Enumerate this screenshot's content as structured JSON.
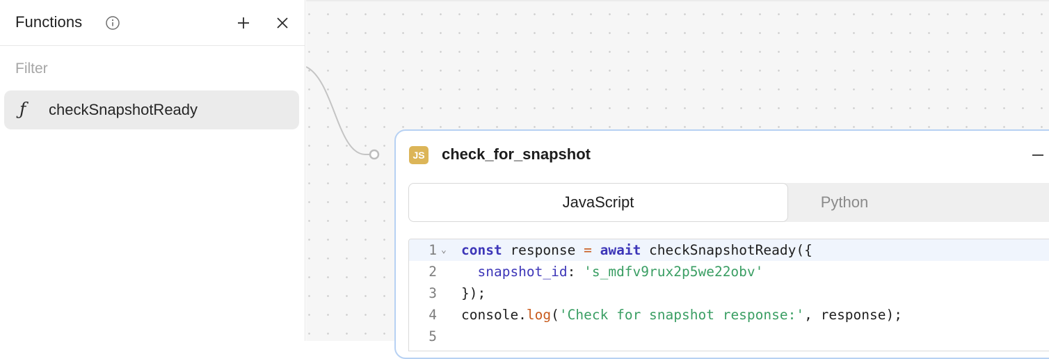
{
  "sidebar": {
    "title": "Functions",
    "filter_placeholder": "Filter",
    "items": [
      {
        "glyph": "ƒ",
        "label": "checkSnapshotReady"
      }
    ]
  },
  "node": {
    "badge": "JS",
    "title": "check_for_snapshot",
    "tabs": [
      {
        "label": "JavaScript",
        "active": true
      },
      {
        "label": "Python",
        "active": false
      }
    ],
    "line_numbers": [
      "1",
      "2",
      "3",
      "4",
      "5"
    ],
    "code": {
      "line1": {
        "kw1": "const",
        "t1": " response ",
        "op": "=",
        "t2": " ",
        "kw2": "await",
        "t3": " checkSnapshotReady({"
      },
      "line2": {
        "indent": "  ",
        "prop": "snapshot_id",
        "t1": ": ",
        "str": "'s_mdfv9rux2p5we22obv'"
      },
      "line3": {
        "t1": "});"
      },
      "line4": {
        "t1": "console.",
        "meth": "log",
        "t2": "(",
        "str": "'Check for snapshot response:'",
        "t3": ", response);"
      }
    }
  },
  "colors": {
    "accent_border": "#b7d1f3",
    "js_badge": "#dcb558",
    "keyword": "#3d36b8",
    "string": "#3a9e63",
    "operator": "#c85a1c"
  },
  "icons": [
    "info-icon",
    "plus-icon",
    "close-icon",
    "function-icon",
    "js-icon",
    "minimize-icon",
    "fold-chevron-icon"
  ]
}
